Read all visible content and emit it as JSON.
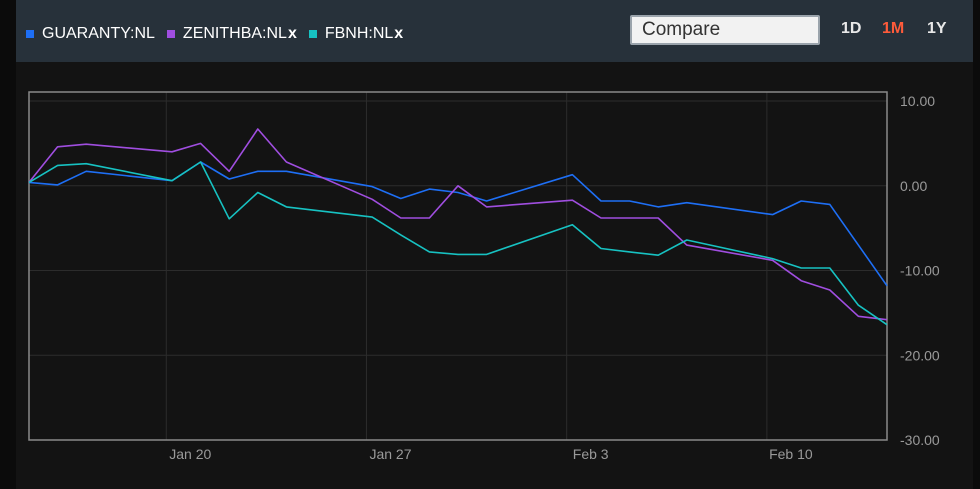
{
  "toolbar": {
    "legend": [
      {
        "name": "GUARANTY:NL",
        "color": "#1e6ff5",
        "removable": false
      },
      {
        "name": "ZENITHBA:NL",
        "color": "#a04ee0",
        "removable": true
      },
      {
        "name": "FBNH:NL",
        "color": "#17c2c2",
        "removable": true
      }
    ],
    "remove_label": "x",
    "compare_placeholder": "Compare",
    "ranges": [
      {
        "label": "1D",
        "active": false
      },
      {
        "label": "1M",
        "active": true
      },
      {
        "label": "1Y",
        "active": false
      }
    ]
  },
  "chart_data": {
    "type": "line",
    "x_tick_labels": [
      "Jan 20",
      "Jan 27",
      "Feb 3",
      "Feb 10"
    ],
    "x_tick_days": [
      20,
      27,
      34,
      41
    ],
    "y_tick_labels": [
      "10.00",
      "0.00",
      "-10.00",
      "-20.00",
      "-30.00"
    ],
    "ylim": [
      -30,
      10
    ],
    "xlim": [
      15.2,
      45.2
    ],
    "grid": true,
    "y_axis_side": "right",
    "series": [
      {
        "name": "GUARANTY:NL",
        "color": "#1e6ff5",
        "x": [
          15.2,
          16.2,
          17.2,
          20.2,
          21.2,
          22.2,
          23.2,
          24.2,
          27.2,
          28.2,
          29.2,
          30.2,
          31.2,
          34.2,
          35.2,
          36.2,
          37.2,
          38.2,
          41.2,
          42.2,
          43.2,
          45.2
        ],
        "y": [
          0.4,
          0.1,
          1.7,
          0.6,
          2.8,
          0.8,
          1.7,
          1.7,
          -0.1,
          -1.5,
          -0.4,
          -0.8,
          -1.8,
          1.3,
          -1.8,
          -1.8,
          -2.5,
          -2.0,
          -3.4,
          -1.8,
          -2.2,
          -11.8
        ]
      },
      {
        "name": "ZENITHBA:NL",
        "color": "#a04ee0",
        "x": [
          15.2,
          16.2,
          17.2,
          20.2,
          21.2,
          22.2,
          23.2,
          24.2,
          27.2,
          28.2,
          29.2,
          30.2,
          31.2,
          34.2,
          35.2,
          36.2,
          37.2,
          38.2,
          41.2,
          42.2,
          43.2,
          44.2,
          45.2
        ],
        "y": [
          0.4,
          4.6,
          4.9,
          4.0,
          5.0,
          1.7,
          6.7,
          2.8,
          -1.6,
          -3.8,
          -3.8,
          0.0,
          -2.5,
          -1.7,
          -3.8,
          -3.8,
          -3.8,
          -7.0,
          -8.8,
          -11.2,
          -12.3,
          -15.4,
          -15.8
        ]
      },
      {
        "name": "FBNH:NL",
        "color": "#17c2c2",
        "x": [
          15.2,
          16.2,
          17.2,
          20.2,
          21.2,
          22.2,
          23.2,
          24.2,
          27.2,
          28.2,
          29.2,
          30.2,
          31.2,
          34.2,
          35.2,
          36.2,
          37.2,
          38.2,
          41.2,
          42.2,
          43.2,
          44.2,
          45.2
        ],
        "y": [
          0.4,
          2.4,
          2.6,
          0.6,
          2.8,
          -3.9,
          -0.8,
          -2.5,
          -3.7,
          -5.8,
          -7.8,
          -8.1,
          -8.1,
          -4.6,
          -7.4,
          -7.8,
          -8.2,
          -6.4,
          -8.6,
          -9.7,
          -9.7,
          -14.1,
          -16.4
        ]
      }
    ]
  }
}
